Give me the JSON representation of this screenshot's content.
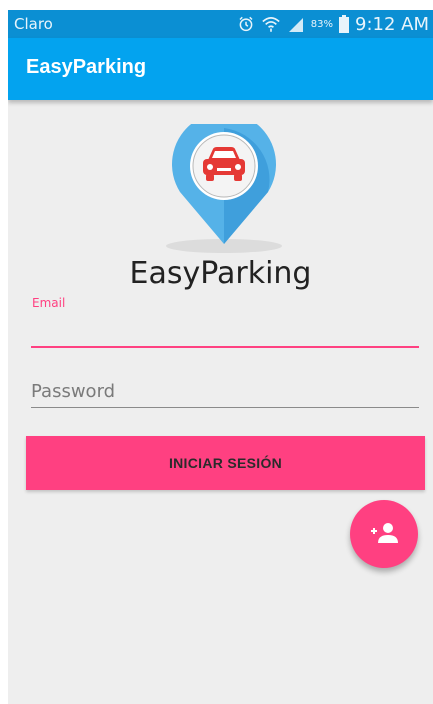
{
  "status_bar": {
    "carrier": "Claro",
    "battery_percent": "83%",
    "time": "9:12 AM",
    "icons": [
      "alarm-icon",
      "wifi-icon",
      "signal-icon",
      "battery-icon"
    ]
  },
  "app_bar": {
    "title": "EasyParking"
  },
  "logo": {
    "icon": "map-pin-car-icon"
  },
  "brand_name": "EasyParking",
  "login_form": {
    "email_label": "Email",
    "email_value": "",
    "password_value": "",
    "password_placeholder": "Password",
    "submit_label": "INICIAR SESIÓN"
  },
  "fab": {
    "icon": "person-add-icon"
  },
  "colors": {
    "status_bar": "#0b8fd3",
    "app_bar": "#03a3ef",
    "accent": "#ff4081",
    "background": "#eeeeee"
  }
}
